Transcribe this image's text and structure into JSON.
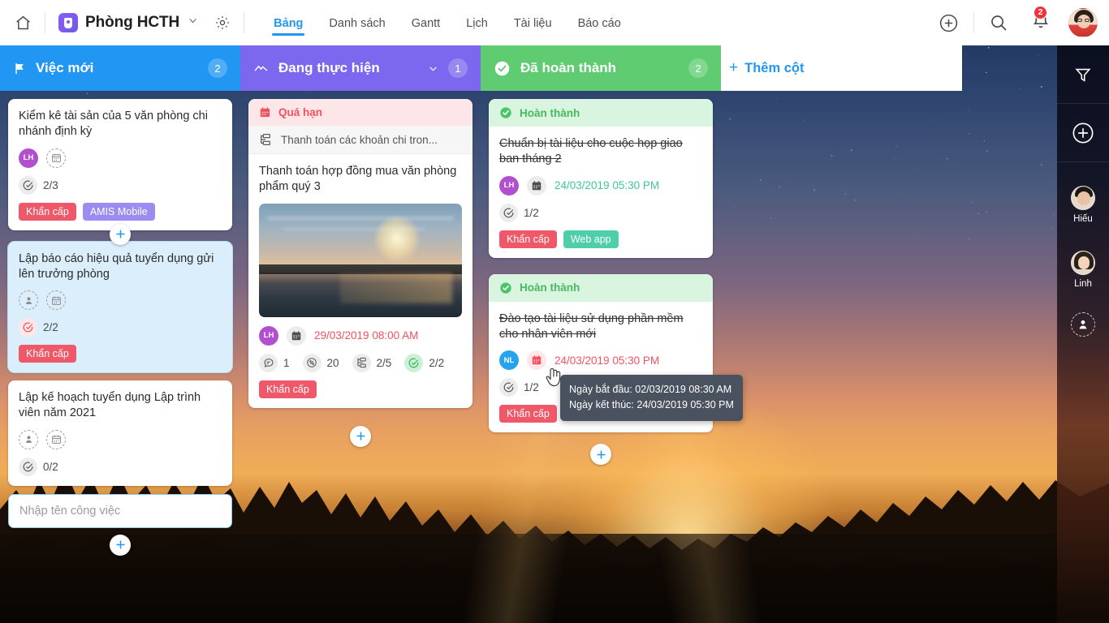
{
  "topbar": {
    "home_icon": "home-icon",
    "project_title": "Phòng HCTH",
    "settings_icon": "gear-icon",
    "tabs": [
      {
        "label": "Bảng",
        "active": true
      },
      {
        "label": "Danh sách",
        "active": false
      },
      {
        "label": "Gantt",
        "active": false
      },
      {
        "label": "Lịch",
        "active": false
      },
      {
        "label": "Tài liệu",
        "active": false
      },
      {
        "label": "Báo cáo",
        "active": false
      }
    ],
    "add_icon": "plus-circle-icon",
    "search_icon": "search-icon",
    "bell_icon": "bell-icon",
    "bell_badge": "2",
    "avatar": "user-avatar"
  },
  "board": {
    "columns": [
      {
        "name": "Việc mới",
        "count": "2",
        "color": "#2196f3",
        "icon": "flag-icon",
        "has_caret": false,
        "new_task_placeholder": "Nhập tên công việc",
        "cards": [
          {
            "title": "Kiểm kê tài sản của 5 văn phòng chi nhánh định kỳ",
            "assignee": "LH",
            "assignee_color": "#b24fd0",
            "checklist": "2/3",
            "tags": [
              {
                "label": "Khẩn cấp",
                "color": "#ef5868"
              },
              {
                "label": "AMIS Mobile",
                "color": "#9a8cf0"
              }
            ]
          },
          {
            "title": "Lập báo cáo hiệu quả tuyển dụng gửi lên trưởng phòng",
            "assignee": "",
            "checklist": "2/2",
            "selected": true,
            "tags": [
              {
                "label": "Khẩn cấp",
                "color": "#ef5868"
              }
            ]
          },
          {
            "title": "Lập kế hoạch tuyển dụng Lập trình viên năm 2021",
            "assignee": "",
            "checklist": "0/2",
            "tags": []
          }
        ]
      },
      {
        "name": "Đang thực hiện",
        "count": "1",
        "color": "#7b68ee",
        "icon": "trending-line-icon",
        "has_caret": true,
        "cards": [
          {
            "banner": {
              "label": "Quá hạn",
              "icon": "calendar-icon",
              "type": "overdue"
            },
            "subtask": {
              "label": "Thanh toán các khoản chi tron...",
              "icon": "hierarchy-icon"
            },
            "title": "Thanh toán hợp đồng mua văn phòng phẩm quý 3",
            "has_image": true,
            "image_alt": "city-harbor-sunset-photo",
            "assignee": "LH",
            "assignee_color": "#b24fd0",
            "date": "29/03/2019 08:00 AM",
            "date_color": "#f4515f",
            "stats": [
              {
                "icon": "comment-icon",
                "value": "1"
              },
              {
                "icon": "percent-icon",
                "value": "20"
              },
              {
                "icon": "subtask-icon",
                "value": "2/5"
              },
              {
                "icon": "check-circle-icon",
                "value": "2/2"
              }
            ],
            "tags": [
              {
                "label": "Khẩn cấp",
                "color": "#ef5868"
              }
            ]
          }
        ]
      },
      {
        "name": "Đã hoàn thành",
        "count": "2",
        "color": "#5fcc72",
        "icon": "check-circle-icon",
        "has_caret": false,
        "cards": [
          {
            "banner": {
              "label": "Hoàn thành",
              "icon": "check-circle-icon",
              "type": "done"
            },
            "title": "Chuẩn bị tài liệu cho cuộc họp giao ban tháng 2",
            "done": true,
            "assignee": "LH",
            "assignee_color": "#b24fd0",
            "date": "24/03/2019 05:30 PM",
            "date_color": "#3ec79a",
            "checklist": "1/2",
            "tags": [
              {
                "label": "Khẩn cấp",
                "color": "#ef5868"
              },
              {
                "label": "Web app",
                "color": "#4ecfa9"
              }
            ]
          },
          {
            "banner": {
              "label": "Hoàn thành",
              "icon": "check-circle-icon",
              "type": "done"
            },
            "title": "Đào tạo tài liệu sử dụng phần mềm cho nhân viên mới",
            "done": true,
            "assignee": "NL",
            "assignee_color": "#26a3ef",
            "date": "24/03/2019 05:30 PM",
            "date_color": "#f4515f",
            "checklist": "1/2",
            "tags": [
              {
                "label": "Khẩn cấp",
                "color": "#ef5868"
              }
            ]
          }
        ]
      }
    ],
    "add_column_label": "Thêm cột",
    "add_column_plus": "+"
  },
  "tooltip": {
    "start_line": "Ngày bắt đầu: 02/03/2019 08:30 AM",
    "end_line": "Ngày kết thúc: 24/03/2019 05:30 PM"
  },
  "rail": {
    "filter_icon": "filter-icon",
    "add_icon": "plus-circle-icon",
    "members": [
      {
        "name": "Hiếu"
      },
      {
        "name": "Linh"
      }
    ],
    "add_member_icon": "add-person-icon"
  }
}
